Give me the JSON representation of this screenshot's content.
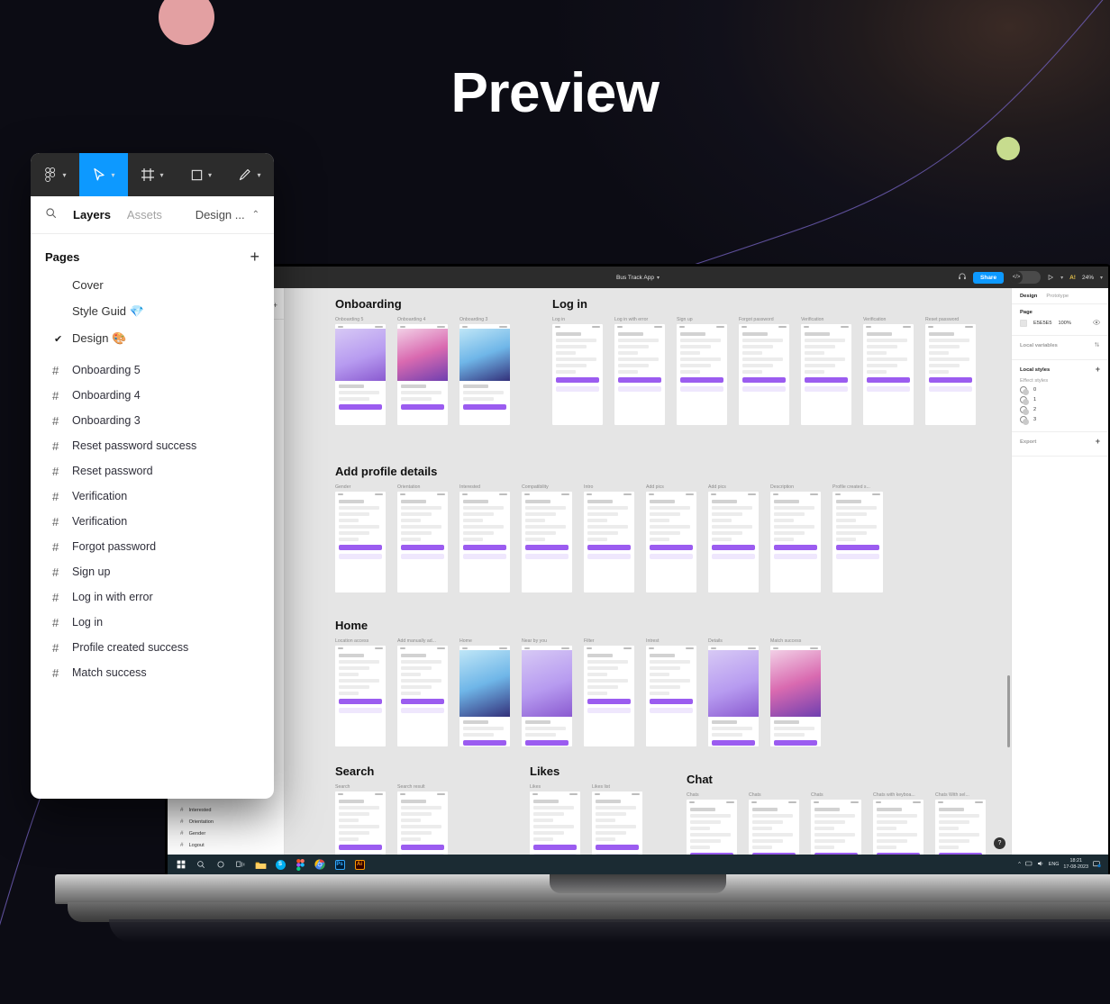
{
  "hero": {
    "title": "Preview"
  },
  "decor": {
    "pink": "#e3a0a2",
    "green": "#c7dc8e",
    "curve": "#6b5bb0"
  },
  "float_panel": {
    "toolbar": [
      {
        "name": "figma-menu-icon",
        "caret": true
      },
      {
        "name": "move-tool-icon",
        "caret": true,
        "active": true
      },
      {
        "name": "frame-tool-icon",
        "caret": true
      },
      {
        "name": "shape-tool-icon",
        "caret": true
      },
      {
        "name": "pen-tool-icon",
        "caret": true
      }
    ],
    "tabs": {
      "search_icon": "search-icon",
      "layers": "Layers",
      "assets": "Assets",
      "design": "Design ...",
      "collapse_icon": "chevron-up-icon"
    },
    "pages_header": {
      "title": "Pages",
      "add_label": "+"
    },
    "pages": [
      {
        "label": "Cover",
        "selected": false
      },
      {
        "label": "Style Guid 💎",
        "selected": false
      },
      {
        "label": "Design 🎨",
        "selected": true
      }
    ],
    "layers": [
      "Onboarding 5",
      "Onboarding 4",
      "Onboarding 3",
      "Reset password success",
      "Reset password",
      "Verification",
      "Verification",
      "Forgot password",
      "Sign up",
      "Log in with error",
      "Log in",
      "Profile created success",
      "Match success"
    ]
  },
  "figma": {
    "toolbar": {
      "tools": [
        "pen-tool-icon",
        "text-tool-icon",
        "components-icon",
        "hand-tool-icon",
        "comment-icon"
      ],
      "filename": "Bus Track App",
      "filename_caret": "chevron-down-icon",
      "headphones_icon": "headphones-icon",
      "share_label": "Share",
      "code_icon": "</>",
      "present_icon": "play-icon",
      "ai_label": "A!",
      "zoom": "24%"
    },
    "left_layers": [
      "Interested",
      "Orientation",
      "Gender",
      "Logout"
    ],
    "right_panel": {
      "tabs": [
        {
          "label": "Design",
          "active": true
        },
        {
          "label": "Prototype",
          "active": false
        }
      ],
      "page": {
        "title": "Page",
        "color_hex": "E5E5E5",
        "opacity": "100%",
        "visibility_icon": "eye-icon"
      },
      "local_variables": {
        "label": "Local variables",
        "icon": "sliders-icon"
      },
      "local_styles": {
        "label": "Local styles",
        "add": "+"
      },
      "effect_styles": {
        "label": "Effect styles",
        "items": [
          "0",
          "1",
          "2",
          "3"
        ]
      },
      "export": {
        "label": "Export",
        "add": "+"
      }
    },
    "help_fab": "?",
    "canvas": {
      "sections": [
        {
          "name": "Onboarding",
          "boards": [
            "Onboarding 5",
            "Onboarding 4",
            "Onboarding 3"
          ]
        },
        {
          "name": "Log in",
          "boards": [
            "Log in",
            "Log in with error",
            "Sign up",
            "Forgot password",
            "Verification",
            "Verification",
            "Reset password"
          ]
        },
        {
          "name": "Add profile details",
          "boards": [
            "Gender",
            "Orientation",
            "Interested",
            "Compatibility",
            "Intro",
            "Add pics",
            "Add pics",
            "Description",
            "Profile created s..."
          ]
        },
        {
          "name": "Home",
          "boards": [
            "Location access",
            "Add manually ad...",
            "Home",
            "Near by you",
            "Filter",
            "Intrest",
            "Details",
            "Match success"
          ]
        },
        {
          "name": "Search",
          "boards": [
            "Search",
            "Search result"
          ]
        },
        {
          "name": "Likes",
          "boards": [
            "Likes",
            "Likes list"
          ]
        },
        {
          "name": "Chat",
          "boards": [
            "Chats",
            "Chats",
            "Chats",
            "Chats with keyboa...",
            "Chats With sel..."
          ]
        }
      ]
    }
  },
  "taskbar": {
    "system": [
      "start-icon",
      "search-icon",
      "cortana-icon",
      "task-view-icon"
    ],
    "apps": [
      {
        "name": "file-explorer-icon",
        "label": "",
        "color": "#f5c242"
      },
      {
        "name": "skype-icon",
        "label": "S",
        "color": "#00aff0"
      },
      {
        "name": "figma-icon",
        "label": "F",
        "color": "#2c2c2c"
      },
      {
        "name": "chrome-icon",
        "label": "",
        "color": "#ffffff"
      },
      {
        "name": "photoshop-icon",
        "label": "Ps",
        "color": "#001e36"
      },
      {
        "name": "illustrator-icon",
        "label": "Ai",
        "color": "#330000"
      }
    ],
    "tray": {
      "chevron": "^",
      "network_icon": "network-icon",
      "volume_icon": "volume-icon",
      "language": "ENG",
      "time": "18:21",
      "date": "17-08-2023",
      "action_center_icon": "notifications-icon"
    }
  }
}
